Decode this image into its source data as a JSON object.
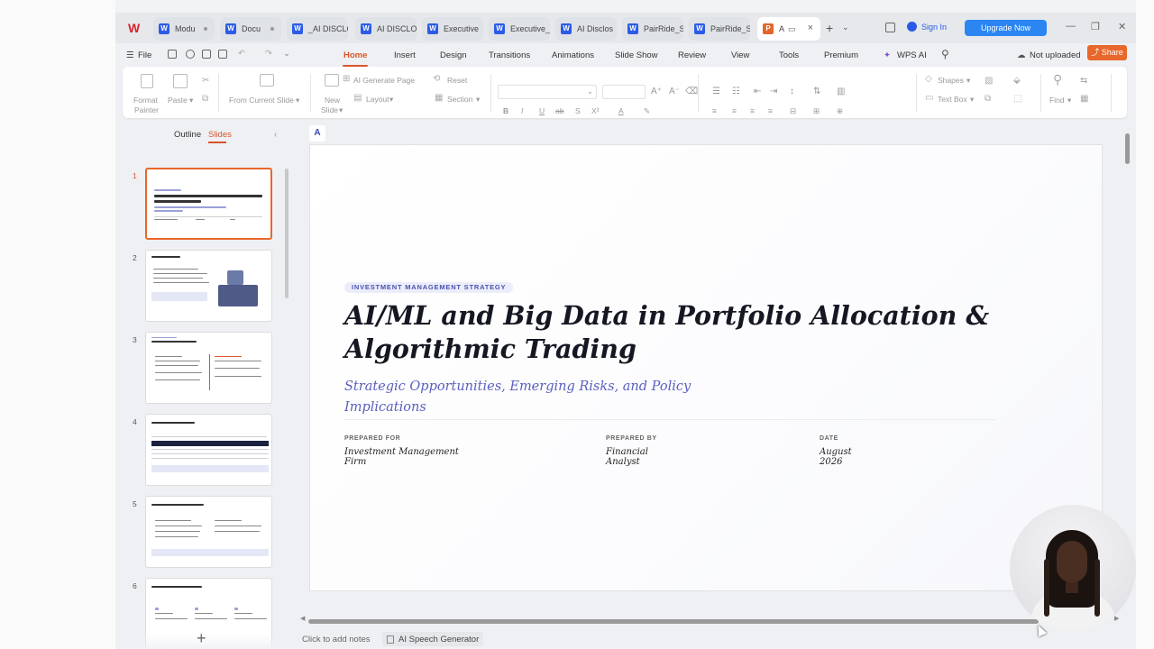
{
  "tabs": [
    {
      "label": "Modu",
      "type": "W",
      "active": false
    },
    {
      "label": "Docu",
      "type": "W",
      "active": false
    },
    {
      "label": "_AI DISCLO",
      "type": "W",
      "active": false
    },
    {
      "label": "AI DISCLO",
      "type": "W",
      "active": false
    },
    {
      "label": "Executive",
      "type": "W",
      "active": false
    },
    {
      "label": "Executive_",
      "type": "W",
      "active": false
    },
    {
      "label": "AI Disclos",
      "type": "W",
      "active": false
    },
    {
      "label": "PairRide_S",
      "type": "W",
      "active": false
    },
    {
      "label": "PairRide_S",
      "type": "W",
      "active": false
    },
    {
      "label": "A",
      "type": "P",
      "active": true
    }
  ],
  "account": {
    "sign_in": "Sign In",
    "upgrade": "Upgrade Now"
  },
  "menu": {
    "file": "File",
    "items": [
      "Home",
      "Insert",
      "Design",
      "Transitions",
      "Animations",
      "Slide Show",
      "Review",
      "View",
      "Tools",
      "Premium"
    ],
    "wps_ai": "WPS AI",
    "not_uploaded": "Not uploaded",
    "share": "Share"
  },
  "ribbon": {
    "format_painter_1": "Format",
    "format_painter_2": "Painter",
    "paste": "Paste",
    "from_current_slide": "From Current Slide",
    "new_slide_1": "New",
    "new_slide_2": "Slide",
    "ai_generate_page": "AI Generate Page",
    "layout": "Layout",
    "reset": "Reset",
    "section": "Section",
    "shapes": "Shapes",
    "text_box": "Text Box",
    "find": "Find"
  },
  "panel": {
    "outline": "Outline",
    "slides": "Slides"
  },
  "thumbnails": [
    {
      "num": "1",
      "active": true
    },
    {
      "num": "2",
      "active": false
    },
    {
      "num": "3",
      "active": false
    },
    {
      "num": "4",
      "active": false
    },
    {
      "num": "5",
      "active": false
    },
    {
      "num": "6",
      "active": false
    }
  ],
  "slide": {
    "tag": "INVESTMENT MANAGEMENT STRATEGY",
    "title_line1": "AI/ML and Big Data in Portfolio Allocation &",
    "title_line2": "Algorithmic Trading",
    "subtitle_line1": "Strategic Opportunities, Emerging Risks, and Policy",
    "subtitle_line2": "Implications",
    "meta": [
      {
        "label": "PREPARED FOR",
        "line1": "Investment Management",
        "line2": "Firm"
      },
      {
        "label": "PREPARED BY",
        "line1": "Financial",
        "line2": "Analyst"
      },
      {
        "label": "DATE",
        "line1": "August",
        "line2": "2026"
      }
    ]
  },
  "status": {
    "notes": "Click to add notes",
    "speech": "AI Speech Generator"
  }
}
